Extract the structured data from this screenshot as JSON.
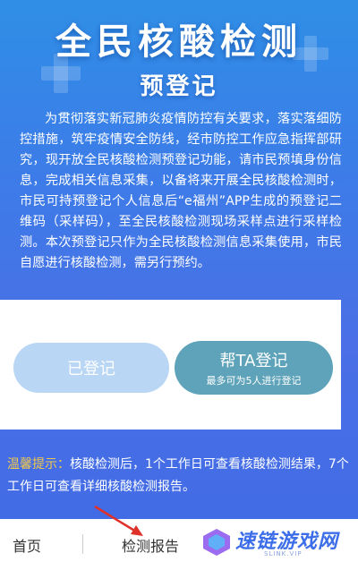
{
  "header": {
    "title": "全民核酸检测",
    "subtitle": "预登记"
  },
  "intro": {
    "text": "为贯彻落实新冠肺炎疫情防控有关要求，落实落细防控措施，筑牢疫情安全防线，经市防控工作应急指挥部研究，现开放全民核酸检测预登记功能，请市民预填身份信息，完成相关信息采集，以备将来开展全民核酸检测时，市民可持预登记个人信息后“e福州”APP生成的预登记二维码（采样码），至全民核酸检测现场采样点进行采样检测。本次预登记只作为全民核酸检测信息采集使用，市民自愿进行核酸检测，需另行预约。"
  },
  "actions": {
    "registered_label": "已登记",
    "help_label": "帮TA登记",
    "help_sub": "最多可为5人进行登记"
  },
  "tips": {
    "label": "温馨提示：",
    "text": "核酸检测后，1个工作日可查看核酸检测结果，7个工作日可查看详细核酸检测报告。"
  },
  "footer": {
    "home_label": "首页",
    "report_label": "检测报告"
  },
  "watermark": {
    "text": "速链游戏网",
    "sub": "SLINK.VIP"
  },
  "colors": {
    "accent": "#3a7fe8",
    "help_button": "#5ea3b9",
    "registered_button": "#b9d6f5",
    "tip_label": "#f2c94c",
    "arrow": "#e0302a"
  }
}
